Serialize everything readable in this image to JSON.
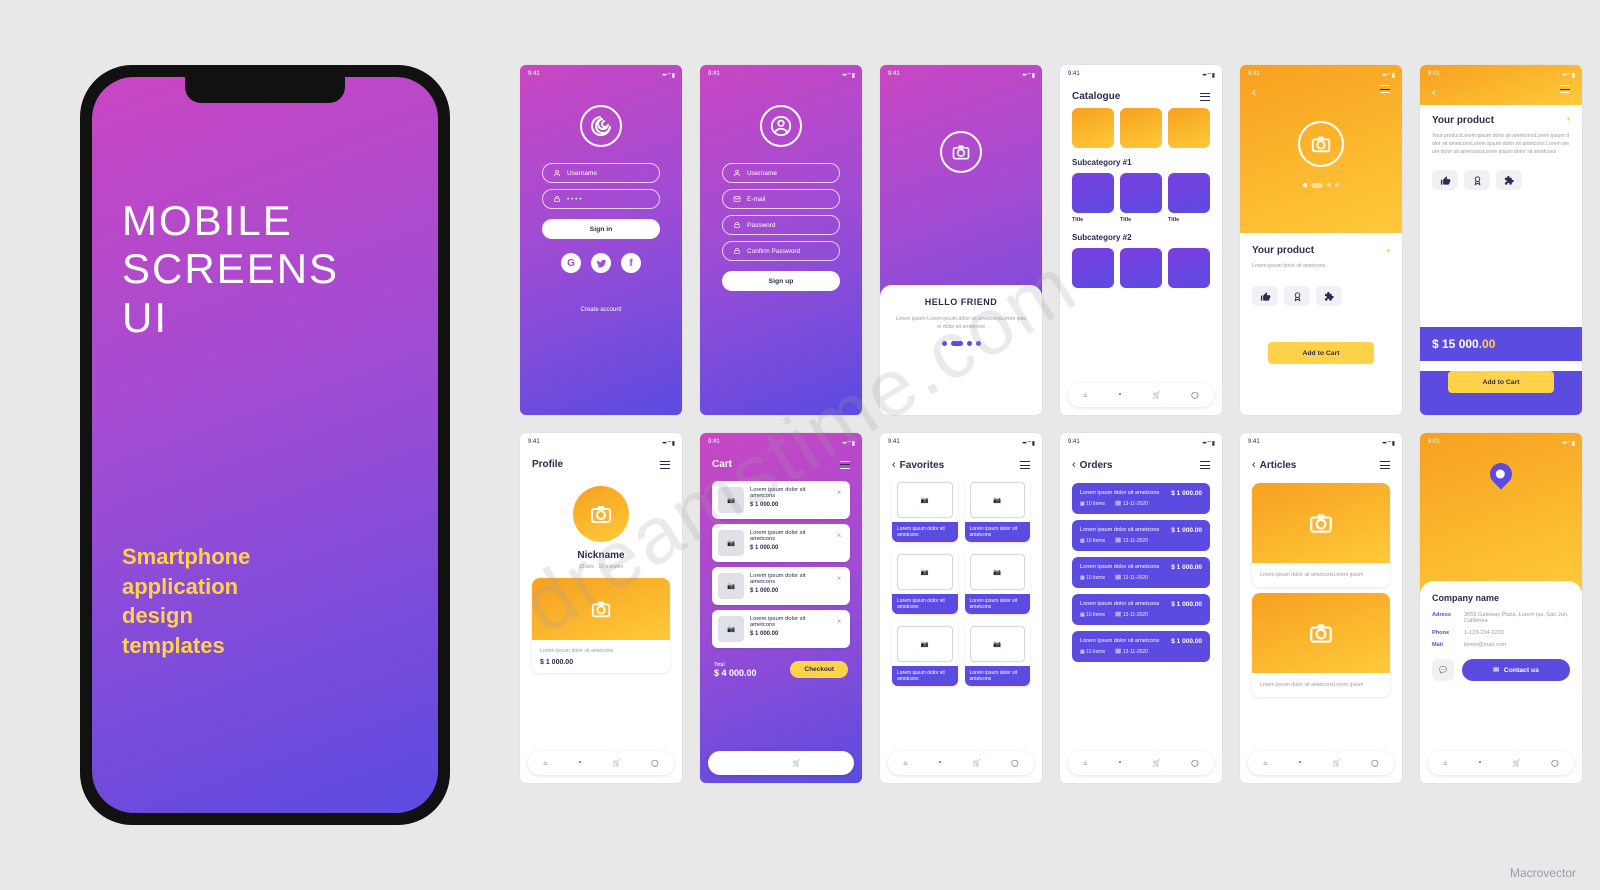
{
  "time": "9:41",
  "hero": {
    "title_l1": "MOBILE",
    "title_l2": "SCREENS",
    "title_l3": "UI",
    "sub_l1": "Smartphone",
    "sub_l2": "application",
    "sub_l3": "design",
    "sub_l4": "templates"
  },
  "signin": {
    "username": "Username",
    "password": "•  •  •  •",
    "button": "Sign in",
    "create": "Create account"
  },
  "signup": {
    "username": "Username",
    "email": "E-mail",
    "password": "Password",
    "confirm": "Confirm Password",
    "button": "Sign up"
  },
  "onboard": {
    "title": "HELLO FRIEND",
    "body": "Lorem ipsum Lorem ipsum dolor sit ametconsLorem ipsum dolor sit ametcons"
  },
  "catalogue": {
    "title": "Catalogue",
    "sub1": "Subcategory #1",
    "sub2": "Subcategory #2",
    "thumb_label": "Title"
  },
  "product1": {
    "back": "‹",
    "title": "Your product",
    "desc": "Lorem ipsum dolor sit ametcons",
    "addcart": "Add to Cart"
  },
  "product2": {
    "title": "Your product",
    "desc": "Your productLorem ipsum dolor sit ametconsLorem ipsum dolor sit ametconsLorem ipsum dolor sit ametcons Lorem ipsum dolor sit ametconsLorem ipsum dolor sit ametcons",
    "price_main": "$ 15 000",
    "price_dec": ".00",
    "addcart": "Add to Cart"
  },
  "profile": {
    "title": "Profile",
    "nickname": "Nickname",
    "meta": "15 ans · 10 minutes",
    "card_desc": "Lorem ipsum dolor sit ametcons",
    "price": "$ 1 000.00"
  },
  "cart": {
    "title": "Cart",
    "item_title": "Lorem ipsum dolor sit ametcons",
    "item_price": "$ 1 000.00",
    "total_label": "Total",
    "total": "$ 4 000.00",
    "checkout": "Checkout"
  },
  "favorites": {
    "title": "Favorites",
    "caption": "Lorem ipsum dolor sit ametcons"
  },
  "orders": {
    "title": "Orders",
    "line": "Lorem ipsum dolor sit ametcons",
    "price": "$ 1 000.00",
    "items": "10 items",
    "date": "13-11-2020"
  },
  "articles": {
    "title": "Articles",
    "body": "Lorem ipsum dolor sit ametconsLorem ipsum"
  },
  "contact": {
    "company": "Company name",
    "k_address": "Adress",
    "v_address": "3059 Gateway Plaza, Lorem ips, San Jun, California",
    "k_phone": "Phone",
    "v_phone": "1-123-234-2233",
    "k_mail": "Mail",
    "v_mail": "lorem@mail.com",
    "button": "Contact us"
  },
  "watermark": "dreamstime.com",
  "credit": "Macrovector"
}
